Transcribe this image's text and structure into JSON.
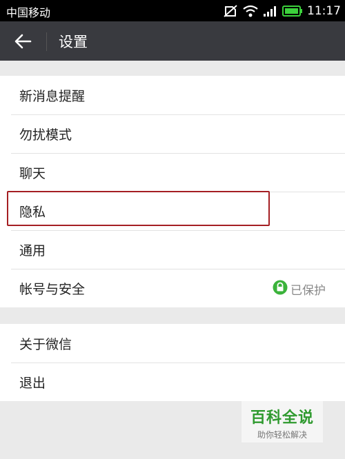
{
  "status_bar": {
    "carrier": "中国移动",
    "time": "11:17",
    "icons": [
      "no-sim-icon",
      "wifi-icon",
      "signal-icon",
      "battery-icon"
    ],
    "battery_color": "#3cd23c"
  },
  "app_bar": {
    "title": "设置",
    "back_icon": "back-arrow-icon",
    "background": "#393a3f"
  },
  "settings_group_1": [
    {
      "label": "新消息提醒"
    },
    {
      "label": "勿扰模式"
    },
    {
      "label": "聊天"
    },
    {
      "label": "隐私"
    },
    {
      "label": "通用"
    },
    {
      "label": "帐号与安全",
      "badge": "已保护",
      "badge_icon": "lock-icon"
    }
  ],
  "settings_group_2": [
    {
      "label": "关于微信"
    },
    {
      "label": "退出"
    }
  ],
  "highlight_color": "#a41e22",
  "watermark": {
    "title": "百科全说",
    "subtitle": "助你轻松解决"
  }
}
